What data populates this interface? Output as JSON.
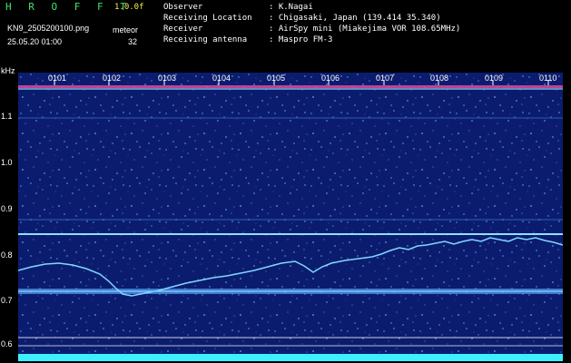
{
  "header": {
    "brand": "H R O F F T",
    "version": "1.0.0f",
    "filename": "KN9_2505200100.png",
    "datetime": "25.05.20 01:00",
    "meteor_label": "meteor",
    "meteor_count": "32",
    "fields": [
      {
        "label": "Observer",
        "value": ": K.Nagai"
      },
      {
        "label": "Receiving Location",
        "value": ": Chigasaki, Japan (139.414 35.340)"
      },
      {
        "label": "Receiver",
        "value": ": AirSpy mini (Miakejima VOR 108.65MHz)"
      },
      {
        "label": "Receiving antenna",
        "value": ": Maspro FM-3"
      }
    ]
  },
  "spectrogram": {
    "unit": "kHz",
    "y_ticks": [
      "1.1",
      "1.0",
      "0.9",
      "0.8",
      "0.7",
      "0.6"
    ],
    "x_ticks": [
      "0101",
      "0102",
      "0103",
      "0104",
      "0105",
      "0106",
      "0107",
      "0108",
      "0109",
      "0110"
    ],
    "colors": {
      "background": "#0b1c6e",
      "signal": "#7fd6ff",
      "marker": "#ff4fa0",
      "baseline": "#3cf0ff"
    }
  }
}
